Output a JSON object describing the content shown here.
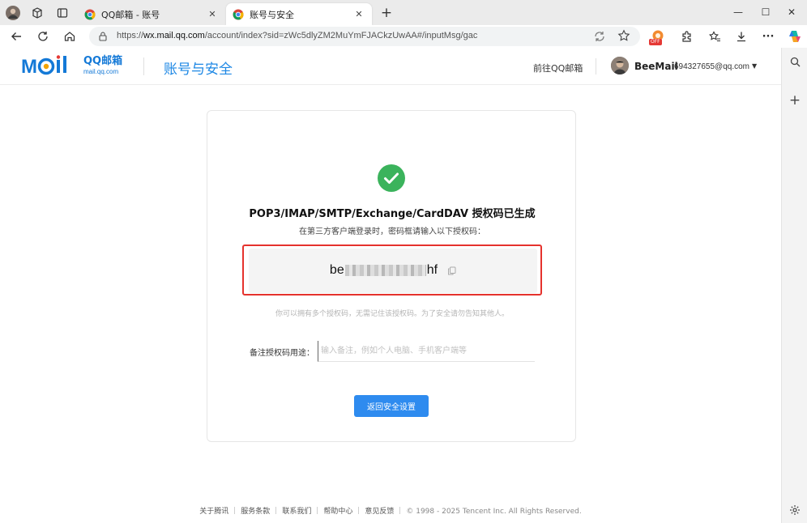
{
  "browser": {
    "tabs": [
      {
        "title": "QQ邮箱 - 账号",
        "active": false
      },
      {
        "title": "账号与安全",
        "active": true
      }
    ],
    "url_prefix": "https://",
    "url_host": "wx.mail.qq.com",
    "url_path": "/account/index?sid=zWc5dlyZM2MuYmFJACkzUwAA#/inputMsg/gac",
    "extension_badge": "OFF"
  },
  "header": {
    "logo_qq": "QQ邮箱",
    "logo_domain": "mail.qq.com",
    "title": "账号与安全",
    "goto_link": "前往QQ邮箱",
    "user_name": "BeeMail",
    "user_email": "694327655@qq.com"
  },
  "card": {
    "title": "POP3/IMAP/SMTP/Exchange/CardDAV 授权码已生成",
    "subtitle": "在第三方客户端登录时，密码框请输入以下授权码：",
    "code_start": "be",
    "code_end": "hf",
    "note": "你可以拥有多个授权码，无需记住该授权码。为了安全请勿告知其他人。",
    "remark_label": "备注授权码用途：",
    "remark_placeholder": "输入备注，例如个人电脑、手机客户端等",
    "back_button": "返回安全设置"
  },
  "footer": {
    "links": [
      "关于腾讯",
      "服务条款",
      "联系我们",
      "帮助中心",
      "意见反馈"
    ],
    "copyright": "© 1998 - 2025 Tencent Inc. All Rights Reserved."
  },
  "colors": {
    "accent": "#1e88e5",
    "button": "#2e8bef",
    "success": "#3bb35c",
    "highlight": "#e5322d"
  }
}
